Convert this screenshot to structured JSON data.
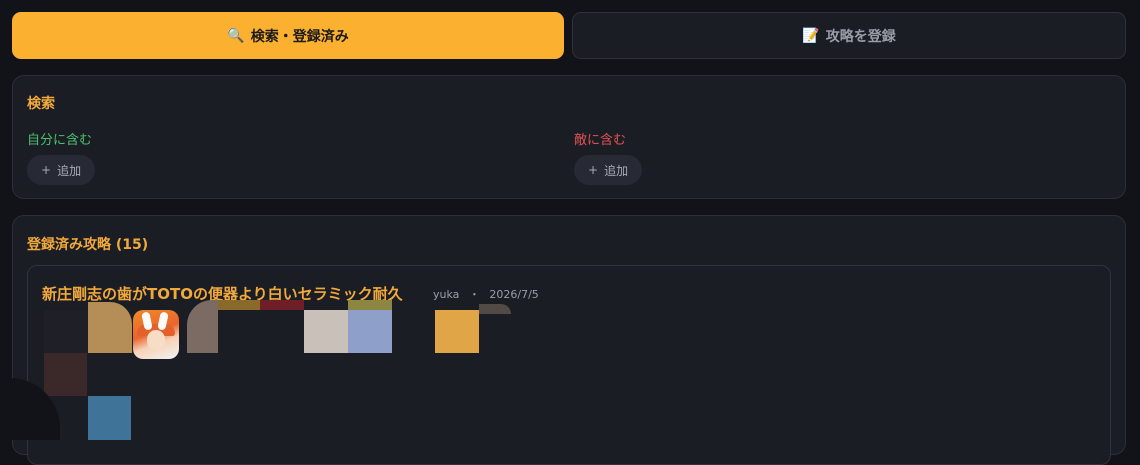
{
  "tabs": [
    {
      "icon": "search-icon",
      "glyph": "🔍",
      "label": "検索・登録済み"
    },
    {
      "icon": "document-icon",
      "glyph": "📝",
      "label": "攻略を登録"
    }
  ],
  "search": {
    "title": "検索",
    "self_label": "自分に含む",
    "enemy_label": "敵に含む",
    "add_plus": "+",
    "add_label": "追加"
  },
  "list": {
    "title": "登録済み攻略 (15)",
    "card": {
      "title": "新庄剛志の歯がTOTOの便器より白いセラミック耐久",
      "author": "yuka",
      "separator": "・",
      "date": "2026/7/5"
    }
  },
  "colors": {
    "accent": "#fbb030",
    "title_orange": "#f2a93b",
    "self_green": "#4cc06a",
    "enemy_red": "#e05252",
    "panel_bg": "#1b1d25",
    "page_bg": "#121318"
  }
}
